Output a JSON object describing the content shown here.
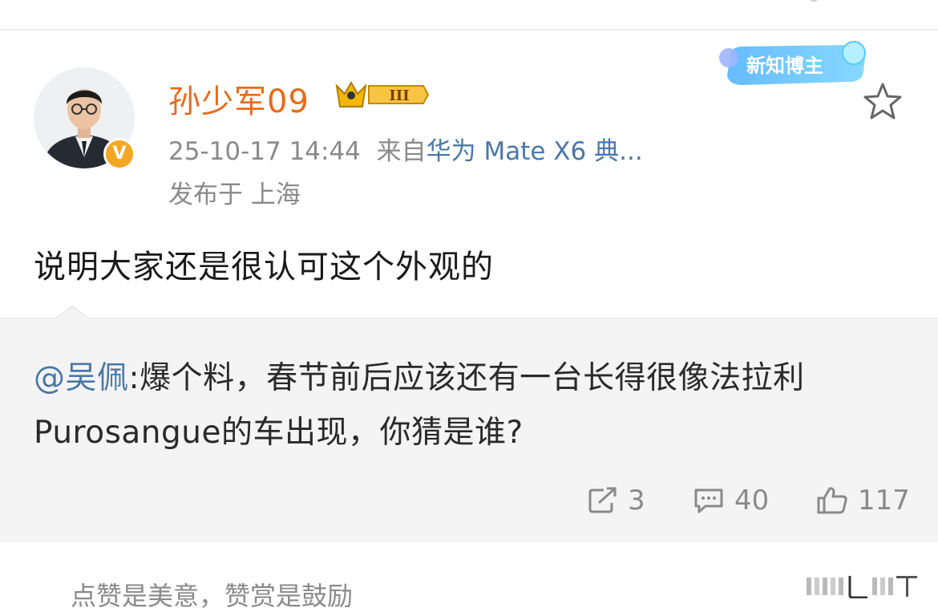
{
  "post": {
    "author": {
      "name": "孙少军09",
      "verified_badge_text": "V",
      "level_badge_text": "III"
    },
    "creator_badge_text": "新知博主",
    "timestamp": "25-10-17 14:44",
    "source_prefix": "来自",
    "source": "华为 Mate X6 典...",
    "location": "发布于 上海",
    "text": "说明大家还是很认可这个外观的",
    "quoted": {
      "mention": "@吴佩",
      "text": ":爆个料，春节前后应该还有一台长得很像法拉利Purosangue的车出现，你猜是谁?"
    },
    "stats": {
      "reposts": "3",
      "comments": "40",
      "likes": "117"
    },
    "reward_text": "点赞是美意，赞赏是鼓励"
  },
  "colors": {
    "name": "#e86b1c",
    "link": "#4a78a8",
    "muted": "#8a8a8a",
    "quote_bg": "#f4f4f4",
    "verify": "#f5a623"
  }
}
